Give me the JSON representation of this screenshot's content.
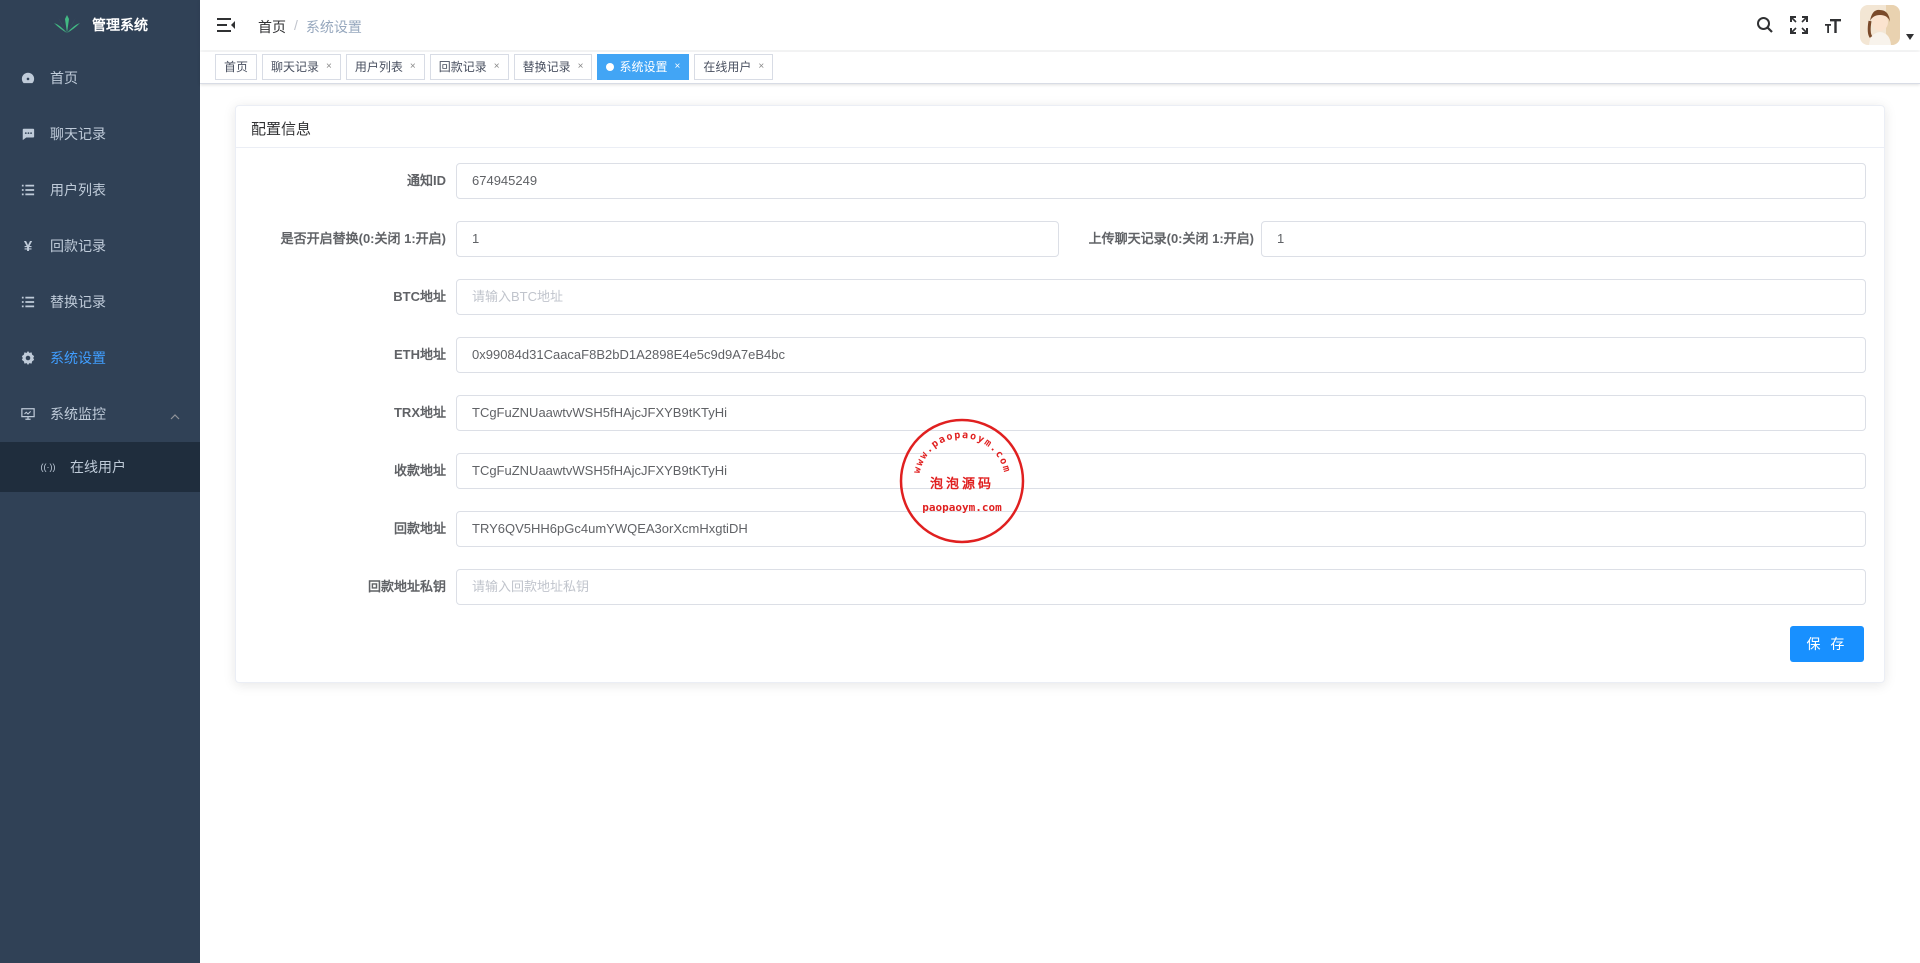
{
  "app": {
    "title": "管理系统"
  },
  "sidebar": {
    "items": [
      {
        "label": "首页",
        "icon": "dashboard-icon"
      },
      {
        "label": "聊天记录",
        "icon": "chat-icon"
      },
      {
        "label": "用户列表",
        "icon": "list-icon"
      },
      {
        "label": "回款记录",
        "icon": "yen-icon"
      },
      {
        "label": "替换记录",
        "icon": "list-icon"
      },
      {
        "label": "系统设置",
        "icon": "gear-icon",
        "active": true
      },
      {
        "label": "系统监控",
        "icon": "monitor-icon",
        "expanded": true
      }
    ],
    "submenu": [
      {
        "label": "在线用户",
        "icon": "online-icon"
      }
    ]
  },
  "breadcrumb": {
    "home": "首页",
    "separator": "/",
    "current": "系统设置"
  },
  "tags": [
    {
      "label": "首页",
      "closable": false
    },
    {
      "label": "聊天记录",
      "closable": true
    },
    {
      "label": "用户列表",
      "closable": true
    },
    {
      "label": "回款记录",
      "closable": true
    },
    {
      "label": "替换记录",
      "closable": true
    },
    {
      "label": "系统设置",
      "closable": true,
      "active": true
    },
    {
      "label": "在线用户",
      "closable": true
    }
  ],
  "tag_close_glyph": "×",
  "card": {
    "title": "配置信息"
  },
  "form": {
    "notify_id": {
      "label": "通知ID",
      "value": "674945249"
    },
    "enable_replace": {
      "label": "是否开启替换(0:关闭 1:开启)",
      "value": "1"
    },
    "upload_chat": {
      "label": "上传聊天记录(0:关闭 1:开启)",
      "value": "1"
    },
    "btc": {
      "label": "BTC地址",
      "value": "",
      "placeholder": "请输入BTC地址"
    },
    "eth": {
      "label": "ETH地址",
      "value": "0x99084d31CaacaF8B2bD1A2898E4e5c9d9A7eB4bc"
    },
    "trx": {
      "label": "TRX地址",
      "value": "TCgFuZNUaawtvWSH5fHAjcJFXYB9tKTyHi"
    },
    "receive": {
      "label": "收款地址",
      "value": "TCgFuZNUaawtvWSH5fHAjcJFXYB9tKTyHi"
    },
    "refund": {
      "label": "回款地址",
      "value": "TRY6QV5HH6pGc4umYWQEA3orXcmHxgtiDH"
    },
    "refund_key": {
      "label": "回款地址私钥",
      "value": "",
      "placeholder": "请输入回款地址私钥"
    }
  },
  "save_button": "保 存",
  "watermark": {
    "top": "www.paopaoym.com",
    "middle": "泡泡源码",
    "bottom": "paopaoym.com"
  },
  "colors": {
    "sidebar_bg": "#304156",
    "active": "#409eff",
    "primary": "#1890ff",
    "tag_active": "#42a5f5",
    "stamp": "#e02020"
  }
}
